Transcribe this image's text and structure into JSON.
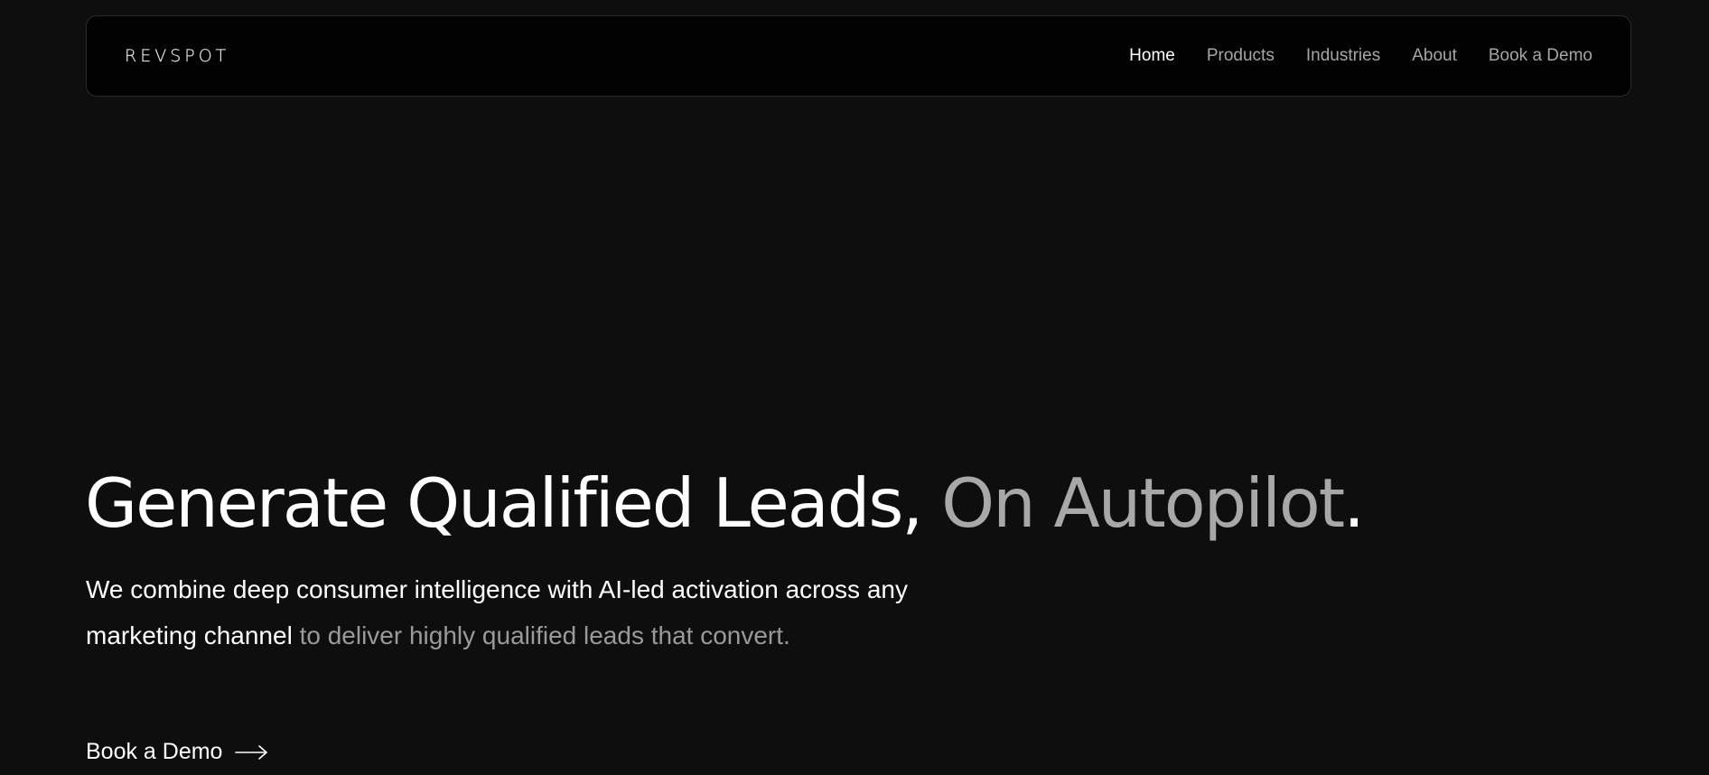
{
  "header": {
    "logo_text": "REVSPOT",
    "nav": [
      {
        "label": "Home",
        "active": true
      },
      {
        "label": "Products",
        "active": false
      },
      {
        "label": "Industries",
        "active": false
      },
      {
        "label": "About",
        "active": false
      },
      {
        "label": "Book a Demo",
        "active": false
      }
    ]
  },
  "hero": {
    "title_main": "Generate Qualified Leads,",
    "title_muted": "On Autopilot",
    "title_end": ".",
    "subtitle_main": "We combine deep consumer intelligence with AI-led activation across any marketing channel",
    "subtitle_muted": "to deliver highly qualified leads that convert.",
    "cta_label": "Book a Demo",
    "cta_icon": "arrow-right-icon"
  },
  "colors": {
    "background": "#0e0e0e",
    "navbar_bg": "#020202",
    "text_primary": "#ffffff",
    "text_muted": "#a8a8a8"
  }
}
